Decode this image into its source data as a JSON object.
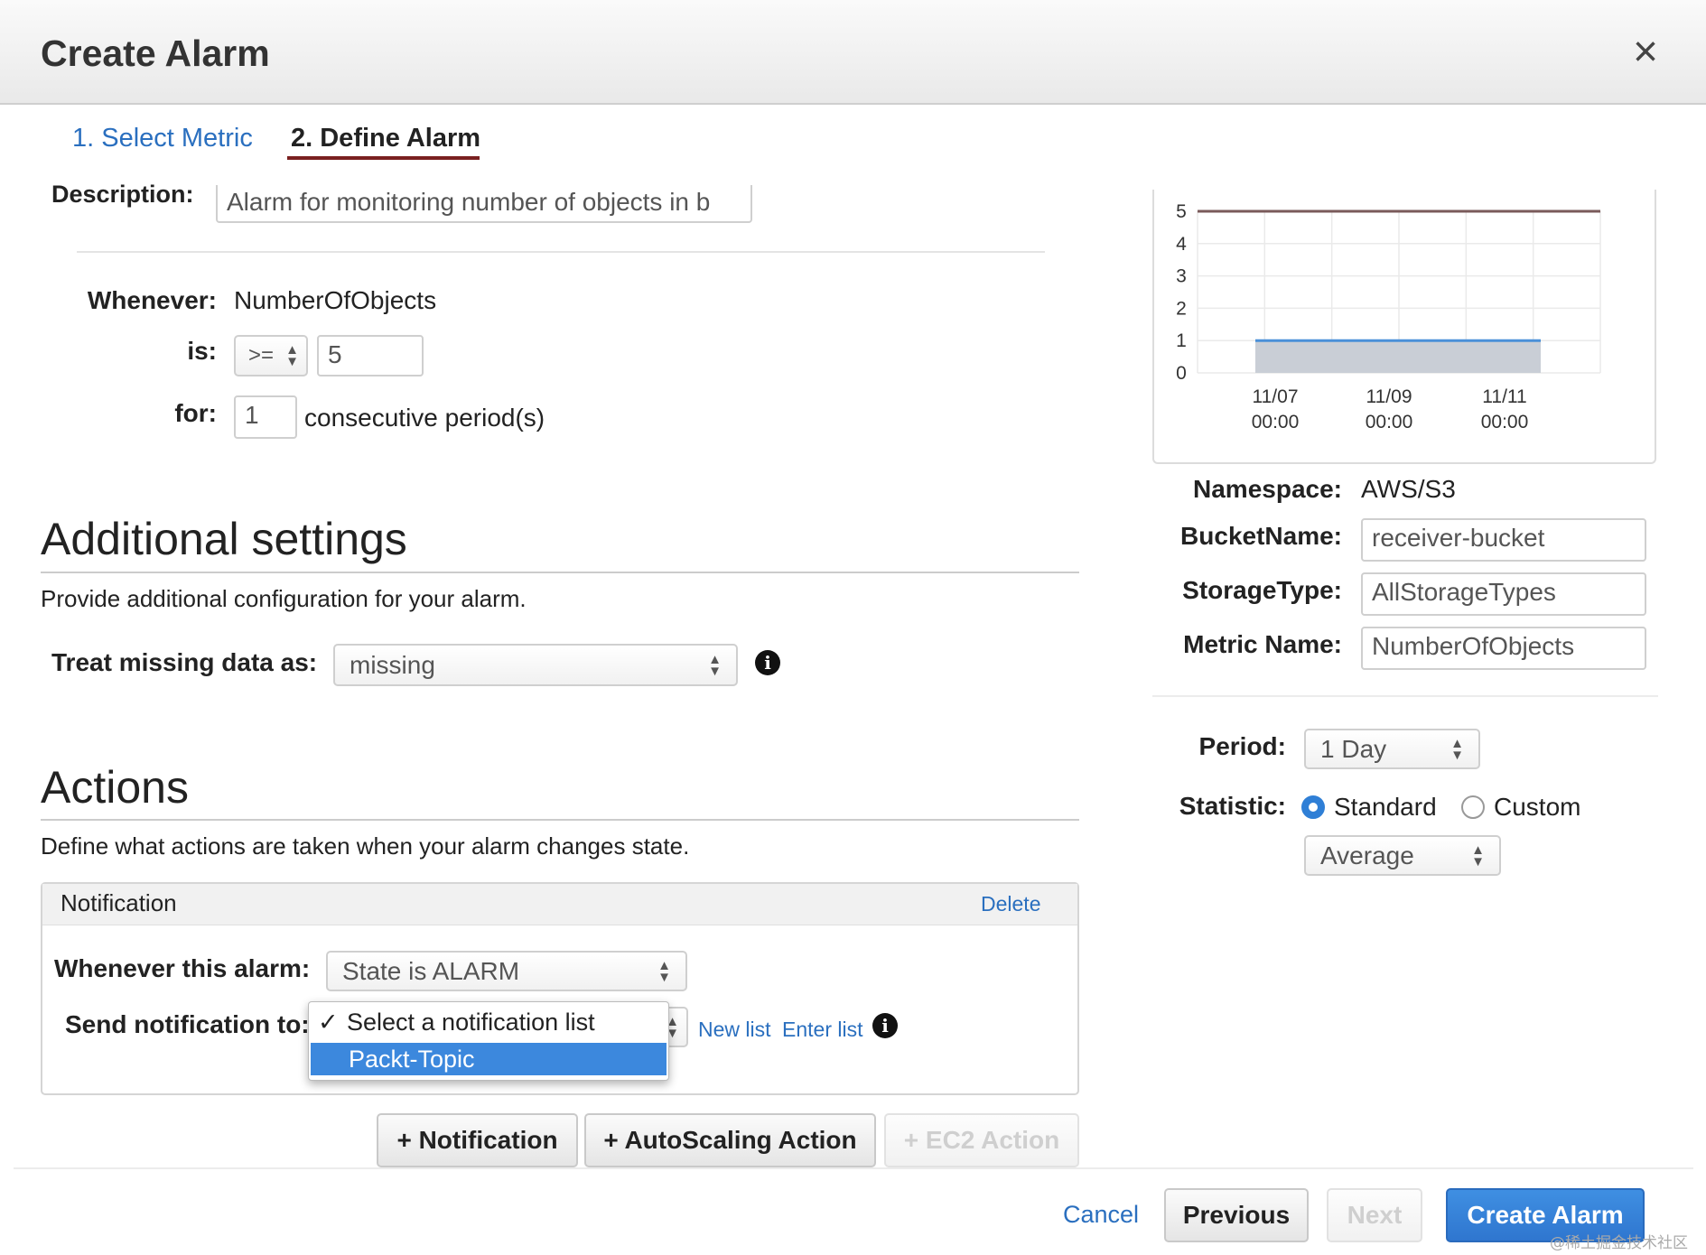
{
  "dialog": {
    "title": "Create Alarm",
    "close_icon": "×"
  },
  "tabs": [
    {
      "label": "1. Select Metric"
    },
    {
      "label": "2. Define Alarm"
    }
  ],
  "alarm": {
    "description_label": "Description:",
    "description_value": "Alarm for monitoring number of objects in b",
    "whenever_label": "Whenever:",
    "whenever_value": "NumberOfObjects",
    "is_label": "is:",
    "operator": ">=",
    "threshold": "5",
    "for_label": "for:",
    "periods": "1",
    "periods_suffix": "consecutive period(s)"
  },
  "additional": {
    "heading": "Additional settings",
    "subtitle": "Provide additional configuration for your alarm.",
    "missing_label": "Treat missing data as:",
    "missing_value": "missing"
  },
  "actions": {
    "heading": "Actions",
    "subtitle": "Define what actions are taken when your alarm changes state.",
    "notification": {
      "title": "Notification",
      "delete": "Delete",
      "whenever_label": "Whenever this alarm:",
      "state_value": "State is ALARM",
      "send_label": "Send notification to:",
      "options": [
        {
          "label": "Select a notification list",
          "checked": true
        },
        {
          "label": "Packt-Topic",
          "highlighted": true
        }
      ],
      "new_list": "New list",
      "enter_list": "Enter list"
    },
    "buttons": {
      "notification": "+ Notification",
      "autoscaling": "+ AutoScaling Action",
      "ec2": "+ EC2 Action"
    }
  },
  "chart_data": {
    "type": "line",
    "y_ticks": [
      "5",
      "4",
      "3",
      "2",
      "1",
      "0"
    ],
    "ylim": [
      0,
      5
    ],
    "x_ticks": [
      {
        "date": "11/07",
        "time": "00:00"
      },
      {
        "date": "11/09",
        "time": "00:00"
      },
      {
        "date": "11/11",
        "time": "00:00"
      }
    ],
    "series": [
      {
        "role": "threshold",
        "values": [
          5,
          5
        ],
        "color": "#7a5a5a"
      },
      {
        "role": "metric",
        "values": [
          1,
          1
        ],
        "color": "#4a90d9",
        "fill": "#c9ced6"
      }
    ],
    "grid": true
  },
  "metric": {
    "namespace_label": "Namespace:",
    "namespace_value": "AWS/S3",
    "bucket_label": "BucketName:",
    "bucket_value": "receiver-bucket",
    "storage_label": "StorageType:",
    "storage_value": "AllStorageTypes",
    "metric_label": "Metric Name:",
    "metric_value": "NumberOfObjects",
    "period_label": "Period:",
    "period_value": "1 Day",
    "statistic_label": "Statistic:",
    "standard": "Standard",
    "custom": "Custom",
    "statistic_value": "Average"
  },
  "footer": {
    "cancel": "Cancel",
    "previous": "Previous",
    "next": "Next",
    "create": "Create Alarm"
  },
  "watermark": "@稀土掘金技术社区",
  "colors": {
    "link": "#2a6fbf",
    "primary": "#2f76cf",
    "highlight": "#3c88dd"
  }
}
